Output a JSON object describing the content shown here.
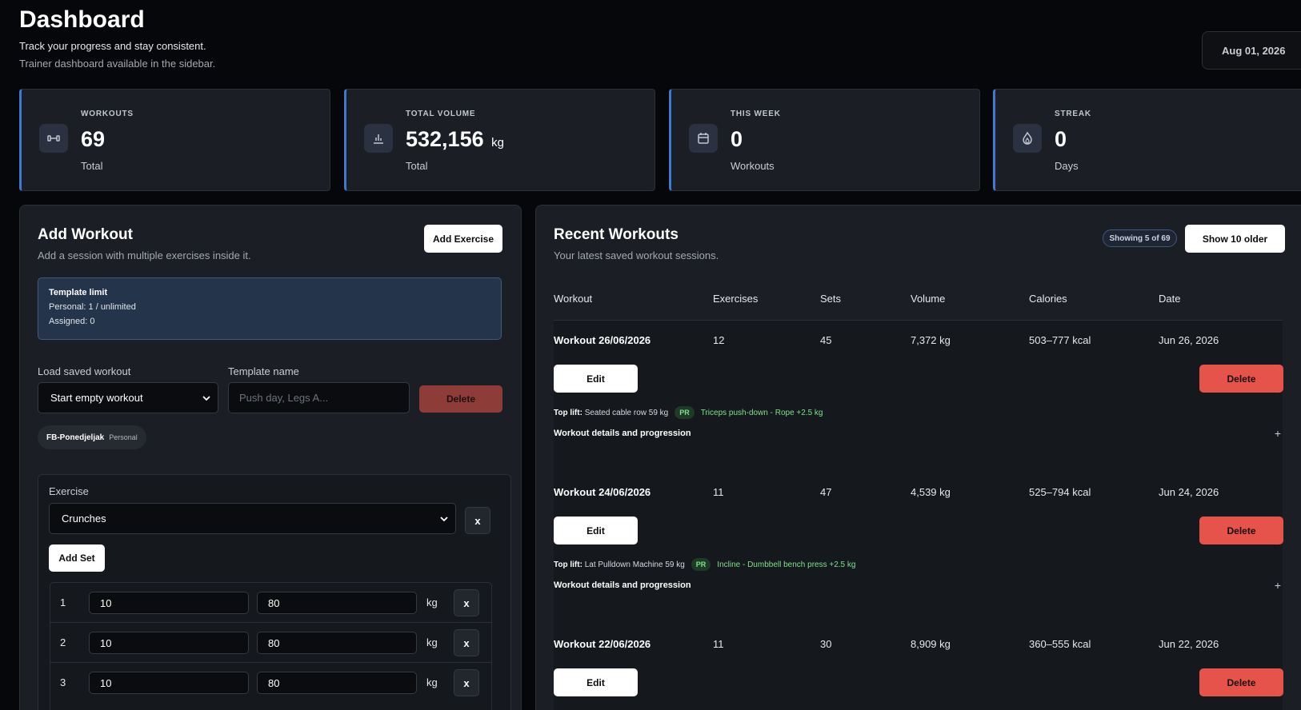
{
  "header": {
    "title": "Dashboard",
    "subtitle": "Track your progress and stay consistent.",
    "note": "Trainer dashboard available in the sidebar.",
    "date": "Aug 01, 2026"
  },
  "stats": [
    {
      "label": "WORKOUTS",
      "value": "69",
      "unit": "",
      "sub": "Total",
      "icon": "dumbbell-icon"
    },
    {
      "label": "TOTAL VOLUME",
      "value": "532,156",
      "unit": "kg",
      "sub": "Total",
      "icon": "bar-chart-icon"
    },
    {
      "label": "THIS WEEK",
      "value": "0",
      "unit": "",
      "sub": "Workouts",
      "icon": "calendar-icon"
    },
    {
      "label": "STREAK",
      "value": "0",
      "unit": "",
      "sub": "Days",
      "icon": "flame-icon"
    }
  ],
  "add_workout": {
    "title": "Add Workout",
    "subtitle": "Add a session with multiple exercises inside it.",
    "add_exercise_label": "Add Exercise",
    "template_box": {
      "title": "Template limit",
      "personal": "Personal: 1 / unlimited",
      "assigned": "Assigned: 0"
    },
    "load_label": "Load saved workout",
    "load_value": "Start empty workout",
    "template_name_label": "Template name",
    "template_name_placeholder": "Push day, Legs A...",
    "delete_label": "Delete",
    "chip": {
      "name": "FB-Ponedjeljak",
      "kind": "Personal"
    },
    "exercise": {
      "label": "Exercise",
      "value": "Crunches",
      "remove_label": "x",
      "add_set_label": "Add Set",
      "sets": [
        {
          "num": "1",
          "reps": "10",
          "weight": "80",
          "unit": "kg",
          "remove": "x"
        },
        {
          "num": "2",
          "reps": "10",
          "weight": "80",
          "unit": "kg",
          "remove": "x"
        },
        {
          "num": "3",
          "reps": "10",
          "weight": "80",
          "unit": "kg",
          "remove": "x"
        }
      ]
    }
  },
  "recent": {
    "title": "Recent Workouts",
    "subtitle": "Your latest saved workout sessions.",
    "showing": "Showing 5 of 69",
    "show_older_label": "Show 10 older",
    "columns": [
      "Workout",
      "Exercises",
      "Sets",
      "Volume",
      "Calories",
      "Date"
    ],
    "edit_label": "Edit",
    "delete_label": "Delete",
    "details_label": "Workout details and progression",
    "top_lift_label": "Top lift:",
    "pr_label": "PR",
    "rows": [
      {
        "name": "Workout 26/06/2026",
        "exercises": "12",
        "sets": "45",
        "volume": "7,372 kg",
        "calories": "503–777 kcal",
        "date": "Jun 26, 2026",
        "top_lift": "Seated cable row 59 kg",
        "pr": "Triceps push-down - Rope +2.5 kg"
      },
      {
        "name": "Workout 24/06/2026",
        "exercises": "11",
        "sets": "47",
        "volume": "4,539 kg",
        "calories": "525–794 kcal",
        "date": "Jun 24, 2026",
        "top_lift": "Lat Pulldown Machine 59 kg",
        "pr": "Incline - Dumbbell bench press +2.5 kg"
      },
      {
        "name": "Workout 22/06/2026",
        "exercises": "11",
        "sets": "30",
        "volume": "8,909 kg",
        "calories": "360–555 kcal",
        "date": "Jun 22, 2026"
      }
    ]
  },
  "colors": {
    "accent": "#3d7bd1",
    "danger": "#e5534b",
    "success": "#7ee28a"
  }
}
